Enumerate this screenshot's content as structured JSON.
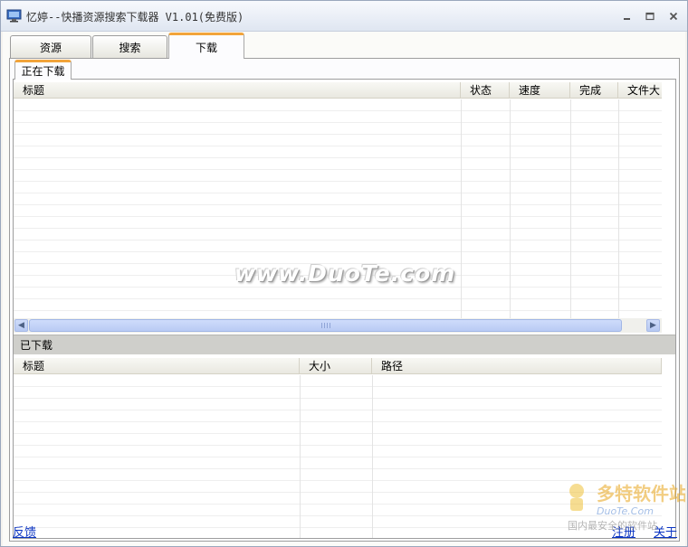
{
  "window": {
    "title": "忆婷--快播资源搜索下载器 V1.01(免费版)"
  },
  "tabs": [
    {
      "label": "资源"
    },
    {
      "label": "搜索"
    },
    {
      "label": "下载"
    }
  ],
  "downloading": {
    "tab_label": "正在下载",
    "columns": [
      "标题",
      "状态",
      "速度",
      "完成",
      "文件大"
    ]
  },
  "downloaded": {
    "section_label": "已下载",
    "columns": [
      "标题",
      "大小",
      "路径"
    ]
  },
  "footer": {
    "feedback": "反馈",
    "register": "注册",
    "about": "关于"
  },
  "watermark": {
    "text": "www.DuoTe.com",
    "logo_text": "多特软件站",
    "logo_sub": "DuoTe.Com",
    "logo_tagline": "国内最安全的软件站"
  },
  "colors": {
    "tab_accent": "#f2a43a",
    "link": "#0b34c2",
    "scroll_thumb": "#b9cbf4"
  },
  "icons": {
    "app": "monitor-icon",
    "minimize": "minimize-icon",
    "maximize": "maximize-icon",
    "close": "close-icon"
  }
}
